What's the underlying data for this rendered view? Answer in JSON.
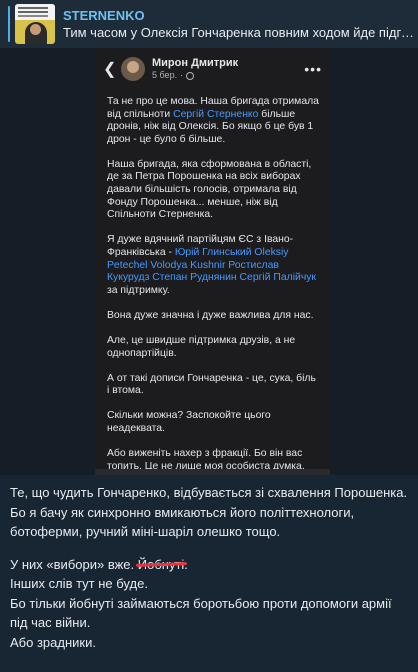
{
  "reply": {
    "author": "STERNENKO",
    "snippet": "Тим часом у Олексія Гончаренка повним ходом йде підготовка"
  },
  "post": {
    "author_name": "Мирон Дмитрик",
    "time": "5 бер.",
    "paragraphs": [
      [
        {
          "t": "Та не про це мова. Наша бригада отримала від спільноти "
        },
        {
          "t": "Сергій Стерненко",
          "link": true
        },
        {
          "t": " більше дронів, ніж від Олексія. Бо якщо б це був 1 дрон - це було б більше."
        }
      ],
      [
        {
          "t": "Наша бригада, яка сформована в області, де за Петра Порошенка на всіх виборах давали більшість голосів, отримала від Фонду Порошенка... менше, ніж від Спільноти Стерненка."
        }
      ],
      [
        {
          "t": "Я дуже вдячний партійцям ЄС з Івано-Франківська - "
        },
        {
          "t": "Юрій Глинський Oleksiy Petechel Volodya Kushnir Ростислав Кукурудз Степан Руднянин Сергій Палійчук",
          "link": true
        },
        {
          "t": " за підтримку."
        }
      ],
      [
        {
          "t": "Вона дуже значна і дуже важлива для нас."
        }
      ],
      [
        {
          "t": "Але, це швидше підтримка друзів, а не однопартійців."
        }
      ],
      [
        {
          "t": "А от такі дописи Гончаренка - це, сука, біль і втома."
        }
      ],
      [
        {
          "t": "Скільки можна? Заспокойте цього неадеквата."
        }
      ],
      [
        {
          "t": "Або виженіть нахер з фракції. Бо він вас топить. Це не лише моя особиста думка."
        }
      ]
    ]
  },
  "caption": {
    "line1": "Те, що чудить Гончаренко, відбувається зі схвалення Порошенка.",
    "line2": "Бо я бачу як синхронно вмикаються його політтехнологи, ботоферми, ручний міні-шаріл олешко тощо.",
    "line3_prefix": "У них «вибори» вже. ",
    "line3_struck": "Йобнуті",
    "line3_suffix": ".",
    "line4": "Інших слів тут не буде.",
    "line5": "Бо тільки йобнуті займаються боротьбою проти допомоги армії під час війни.",
    "line6": "Або зрадники."
  },
  "icons": {
    "back": "arrow-left-icon",
    "privacy": "globe-icon",
    "more": "more-dots-icon"
  },
  "colors": {
    "link": "#4599ff",
    "author": "#6fc0f0",
    "strike": "#e8343d"
  }
}
